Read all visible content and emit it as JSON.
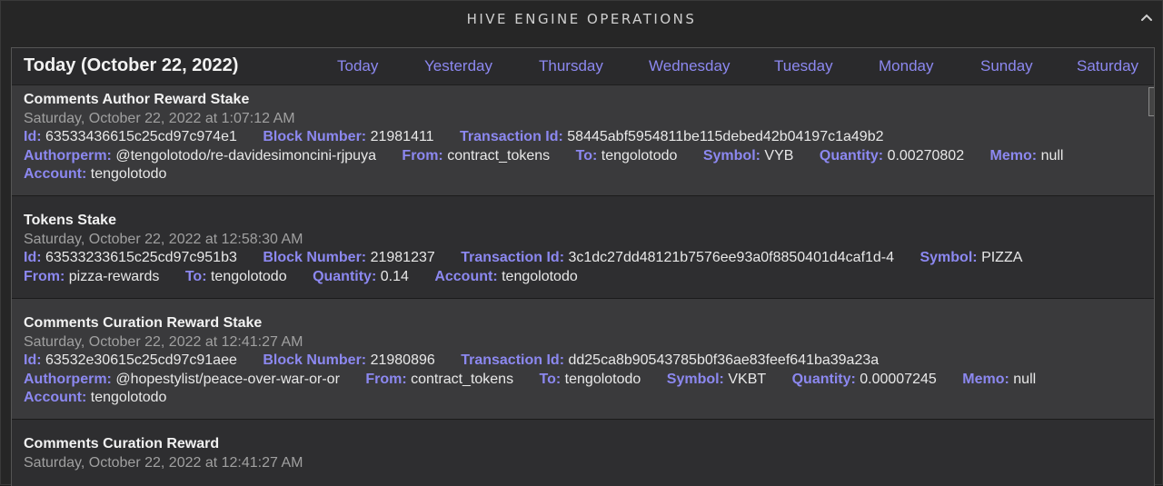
{
  "header": {
    "title": "HIVE ENGINE OPERATIONS"
  },
  "date_bar": {
    "title": "Today (October 22, 2022)",
    "tabs": [
      "Today",
      "Yesterday",
      "Thursday",
      "Wednesday",
      "Tuesday",
      "Monday",
      "Sunday",
      "Saturday"
    ]
  },
  "operations": [
    {
      "title": "Comments Author Reward Stake",
      "time": "Saturday, October 22, 2022 at 1:07:12 AM",
      "line1": {
        "id_label": "Id:",
        "id": "63533436615c25cd97c974e1",
        "block_label": "Block Number:",
        "block": "21981411",
        "tx_label": "Transaction Id:",
        "tx": "58445abf5954811be115debed42b04197c1a49b2"
      },
      "line2": {
        "authorperm_label": "Authorperm:",
        "authorperm": "@tengolotodo/re-davidesimoncini-rjpuya",
        "from_label": "From:",
        "from": "contract_tokens",
        "to_label": "To:",
        "to": "tengolotodo",
        "symbol_label": "Symbol:",
        "symbol": "VYB",
        "quantity_label": "Quantity:",
        "quantity": "0.00270802",
        "memo_label": "Memo:",
        "memo": "null"
      },
      "line3": {
        "account_label": "Account:",
        "account": "tengolotodo"
      }
    },
    {
      "title": "Tokens Stake",
      "time": "Saturday, October 22, 2022 at 12:58:30 AM",
      "line1": {
        "id_label": "Id:",
        "id": "63533233615c25cd97c951b3",
        "block_label": "Block Number:",
        "block": "21981237",
        "tx_label": "Transaction Id:",
        "tx": "3c1dc27dd48121b7576ee93a0f8850401d4caf1d-4",
        "symbol_label": "Symbol:",
        "symbol": "PIZZA"
      },
      "line2": {
        "from_label": "From:",
        "from": "pizza-rewards",
        "to_label": "To:",
        "to": "tengolotodo",
        "quantity_label": "Quantity:",
        "quantity": "0.14",
        "account_label": "Account:",
        "account": "tengolotodo"
      }
    },
    {
      "title": "Comments Curation Reward Stake",
      "time": "Saturday, October 22, 2022 at 12:41:27 AM",
      "line1": {
        "id_label": "Id:",
        "id": "63532e30615c25cd97c91aee",
        "block_label": "Block Number:",
        "block": "21980896",
        "tx_label": "Transaction Id:",
        "tx": "dd25ca8b90543785b0f36ae83feef641ba39a23a"
      },
      "line2": {
        "authorperm_label": "Authorperm:",
        "authorperm": "@hopestylist/peace-over-war-or-or",
        "from_label": "From:",
        "from": "contract_tokens",
        "to_label": "To:",
        "to": "tengolotodo",
        "symbol_label": "Symbol:",
        "symbol": "VKBT",
        "quantity_label": "Quantity:",
        "quantity": "0.00007245",
        "memo_label": "Memo:",
        "memo": "null"
      },
      "line3": {
        "account_label": "Account:",
        "account": "tengolotodo"
      }
    },
    {
      "title": "Comments Curation Reward",
      "time": "Saturday, October 22, 2022 at 12:41:27 AM"
    }
  ]
}
